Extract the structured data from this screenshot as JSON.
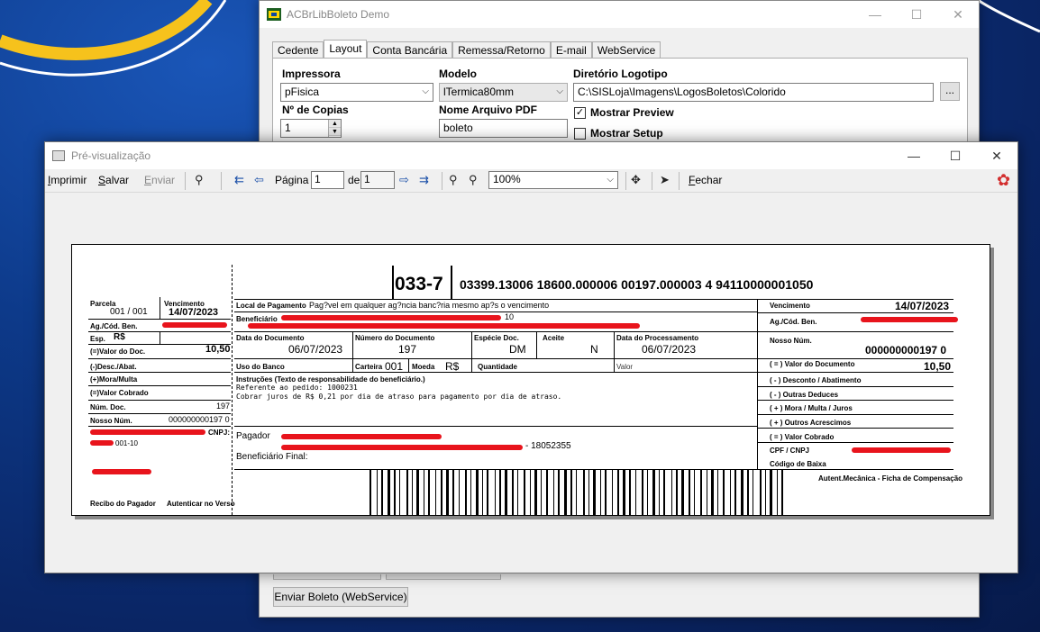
{
  "main_window": {
    "title": "ACBrLibBoleto Demo",
    "tabs": [
      "Cedente",
      "Layout",
      "Conta Bancária",
      "Remessa/Retorno",
      "E-mail",
      "WebService"
    ],
    "active_tab": "Layout",
    "impressora_label": "Impressora",
    "impressora_value": "pFisica",
    "modelo_label": "Modelo",
    "modelo_value": "lTermica80mm",
    "diretorio_label": "Diretório Logotipo",
    "diretorio_value": "C:\\SISLoja\\Imagens\\LogosBoletos\\Colorido",
    "browse_label": "...",
    "copias_label": "Nº de Copias",
    "copias_value": "1",
    "arquivo_label": "Nome Arquivo PDF",
    "arquivo_value": "boleto",
    "preview_label": "Mostrar Preview",
    "preview_checked": true,
    "setup_label": "Mostrar Setup",
    "setup_checked": false,
    "send_button": "Enviar Boleto (WebService)"
  },
  "preview_window": {
    "title": "Pré-visualização",
    "toolbar": {
      "print": "Imprimir",
      "save": "Salvar",
      "send": "Enviar",
      "page_label": "Página",
      "page_value": "1",
      "of_label": "de",
      "of_value": "1",
      "zoom": "100%",
      "close": "Fechar"
    }
  },
  "boleto": {
    "bank_code": "033-7",
    "digitable_line": "03399.13006 18600.000006 00197.000003 4 94110000001050",
    "parcela_lbl": "Parcela",
    "parcela_val": "001 / 001",
    "venc_lbl": "Vencimento",
    "venc_val": "14/07/2023",
    "agcod_lbl": "Ag./Cód. Ben.",
    "esp_lbl": "Esp.",
    "esp_val": "R$",
    "valor_doc_lbl": "(=)Valor do Doc.",
    "valor_doc_val": "10,50",
    "desc_lbl": "(-)Desc./Abat.",
    "mora_lbl": "(+)Mora/Multa",
    "cobrado_lbl": "(=)Valor Cobrado",
    "num_doc_lbl": "Núm. Doc.",
    "num_doc_val": "197",
    "nosso_lbl": "Nosso Núm.",
    "nosso_val": "000000000197 0",
    "cnpj_lbl": "CNPJ:",
    "cnpj_frag": "001-10",
    "recibo_lbl": "Recibo do Pagador",
    "autenticar_lbl": "Autenticar no Verso",
    "local_lbl": "Local de Pagamento",
    "local_val": "Pag?vel em qualquer ag?ncia banc?ria mesmo ap?s o vencimento",
    "beneficiario_lbl": "Beneficiário",
    "benef_frag": "10",
    "data_doc_lbl": "Data do Documento",
    "data_doc_val": "06/07/2023",
    "numero_doc_lbl": "Número do Documento",
    "numero_doc_val": "197",
    "especie_lbl": "Espécie Doc.",
    "especie_val": "DM",
    "aceite_lbl": "Aceite",
    "aceite_val": "N",
    "data_proc_lbl": "Data do Processamento",
    "data_proc_val": "06/07/2023",
    "uso_lbl": "Uso do Banco",
    "carteira_lbl": "Carteira",
    "carteira_val": "001",
    "moeda_lbl": "Moeda",
    "moeda_val": "R$",
    "quantidade_lbl": "Quantidade",
    "valor_lbl": "Valor",
    "instr_lbl": "Instruções (Texto de responsabilidade do beneficiário.)",
    "instr_1": "Referente ao pedido: 1000231",
    "instr_2": "Cobrar juros de R$ 0,21 por dia de atraso para pagamento  por dia de atraso.",
    "pagador_lbl": "Pagador",
    "pagador_cep": "- 18052355",
    "benef_final_lbl": "Beneficiário Final:",
    "r_venc_lbl": "Vencimento",
    "r_venc_val": "14/07/2023",
    "r_agcod_lbl": "Ag./Cód. Ben.",
    "r_nosso_lbl": "Nosso Núm.",
    "r_nosso_val": "000000000197 0",
    "r_valor_doc_lbl": "( = ) Valor do Documento",
    "r_valor_doc_val": "10,50",
    "r_desc_lbl": "( - ) Desconto / Abatimento",
    "r_outras_ded_lbl": "( - ) Outras Deduces",
    "r_mora_lbl": "( + ) Mora / Multa / Juros",
    "r_outros_acr_lbl": "( + ) Outros Acrescimos",
    "r_cobrado_lbl": "( = ) Valor Cobrado",
    "r_cpf_lbl": "CPF / CNPJ",
    "r_baixa_lbl": "Código de Baixa",
    "autent_lbl": "Autent.Mecânica - Ficha de Compensação"
  }
}
